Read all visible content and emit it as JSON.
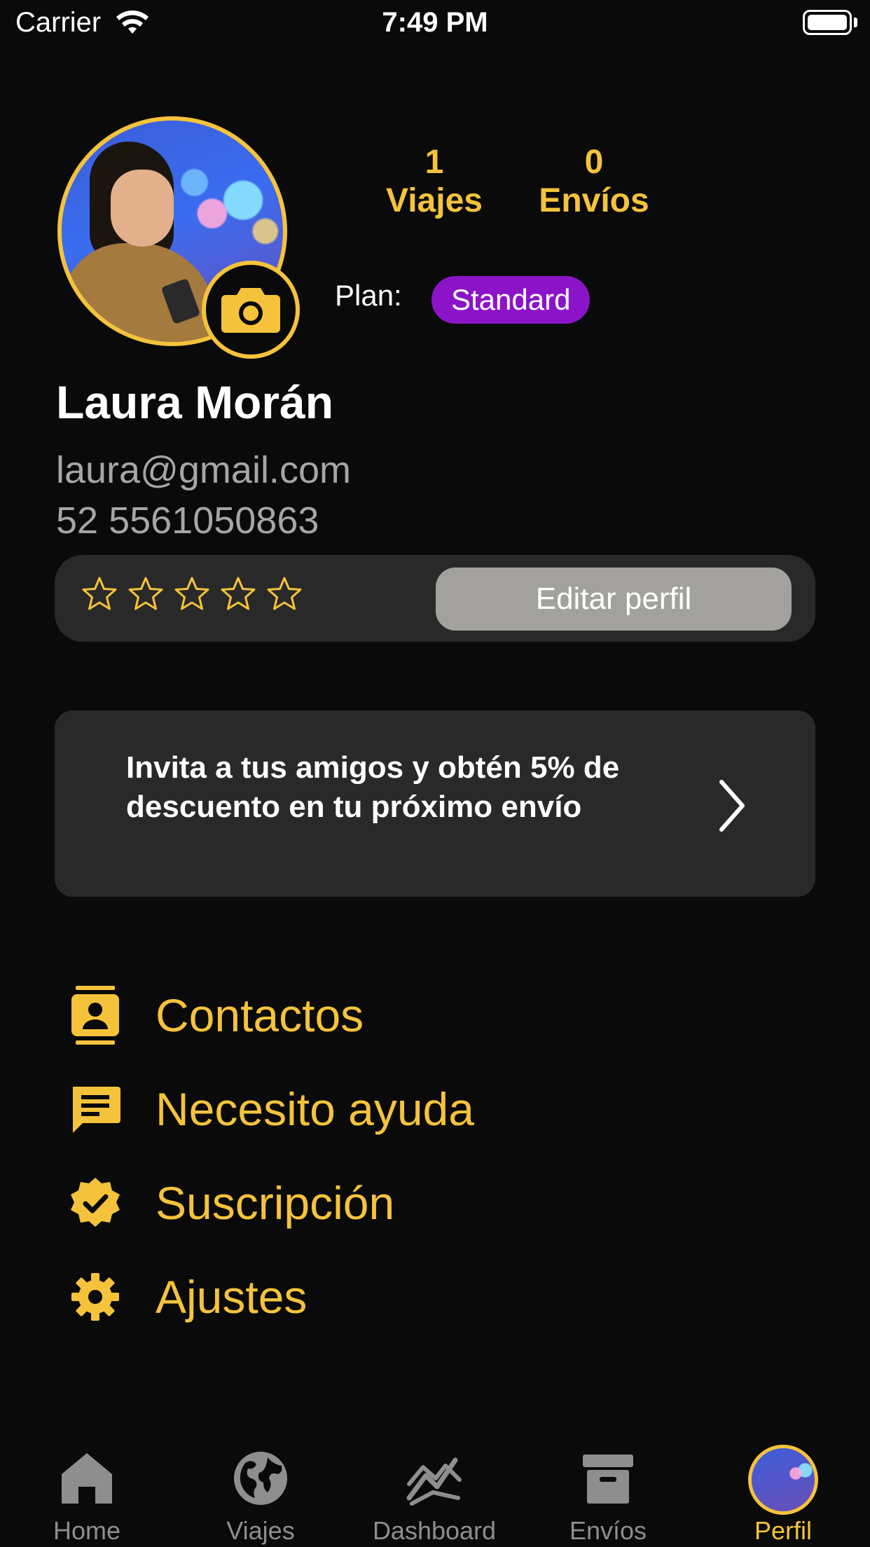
{
  "status_bar": {
    "carrier": "Carrier",
    "time": "7:49 PM"
  },
  "profile": {
    "name": "Laura Morán",
    "email": "laura@gmail.com",
    "phone": "52 5561050863",
    "stats": [
      {
        "value": "1",
        "label": "Viajes"
      },
      {
        "value": "0",
        "label": "Envíos"
      }
    ],
    "plan_label": "Plan:",
    "plan_value": "Standard",
    "rating": 0,
    "rating_max": 5,
    "edit_button": "Editar perfil"
  },
  "invite": {
    "text": "Invita a tus amigos y obtén 5% de descuento en tu próximo envío"
  },
  "menu": [
    {
      "label": "Contactos",
      "icon": "contacts-icon"
    },
    {
      "label": "Necesito ayuda",
      "icon": "chat-icon"
    },
    {
      "label": "Suscripción",
      "icon": "verified-badge-icon"
    },
    {
      "label": "Ajustes",
      "icon": "gear-icon"
    }
  ],
  "tabs": [
    {
      "label": "Home",
      "icon": "home-icon"
    },
    {
      "label": "Viajes",
      "icon": "globe-icon"
    },
    {
      "label": "Dashboard",
      "icon": "chart-line-icon"
    },
    {
      "label": "Envíos",
      "icon": "archive-box-icon"
    },
    {
      "label": "Perfil",
      "icon": "avatar",
      "active": true
    }
  ],
  "colors": {
    "accent": "#f5c33b",
    "plan_badge": "#8c14c8",
    "card": "#2a2929",
    "background": "#0a0a0a"
  }
}
